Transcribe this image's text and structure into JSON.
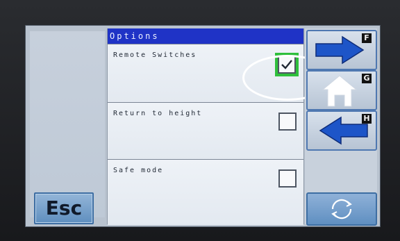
{
  "screen": {
    "title": "Options",
    "options": [
      {
        "label": "Remote Switches",
        "checked": true
      },
      {
        "label": "Return to height",
        "checked": false
      },
      {
        "label": "Safe mode",
        "checked": false
      }
    ]
  },
  "left": {
    "esc_label": "Esc"
  },
  "nav": {
    "forward_key": "F",
    "home_key": "G",
    "back_key": "H",
    "forward_icon": "arrow-right-icon",
    "home_icon": "home-icon",
    "back_icon": "arrow-left-icon",
    "refresh_icon": "refresh-icon"
  },
  "colors": {
    "title_bar": "#1f33c6",
    "arrow_blue": "#1d55c8",
    "check_highlight": "#2fbf3c"
  }
}
